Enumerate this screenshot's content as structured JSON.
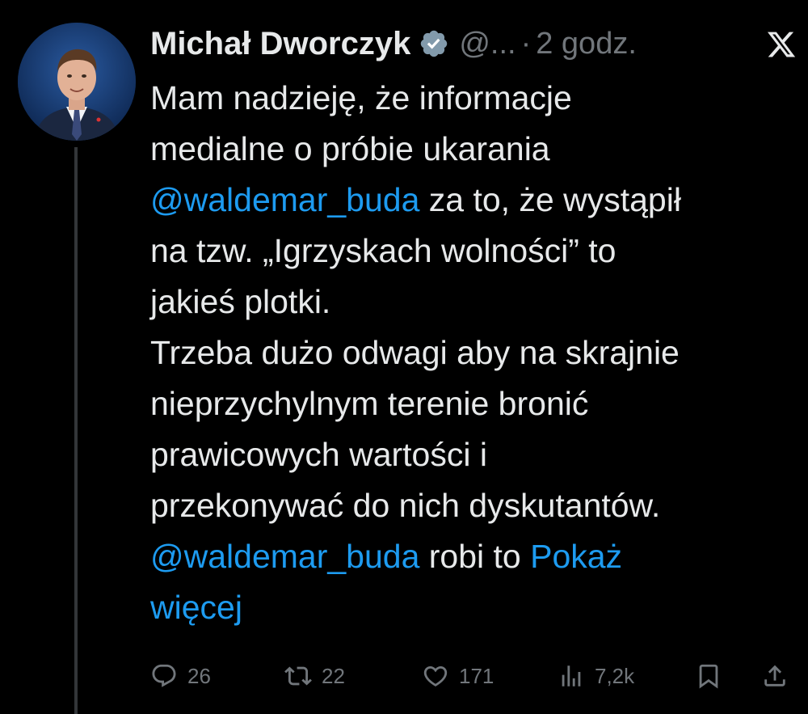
{
  "tweet": {
    "author_name": "Michał Dworczyk",
    "handle": "@...",
    "separator": "·",
    "time": "2 godz.",
    "verified_color": "#829aab",
    "lines": [
      {
        "segments": [
          {
            "text": "Mam nadzieję, że informacje",
            "type": "text"
          }
        ]
      },
      {
        "segments": [
          {
            "text": "medialne o próbie ukarania",
            "type": "text"
          }
        ]
      },
      {
        "segments": [
          {
            "text": "@waldemar_buda",
            "type": "mention"
          },
          {
            "text": " za to, że wystąpił",
            "type": "text"
          }
        ]
      },
      {
        "segments": [
          {
            "text": "na tzw. „Igrzyskach wolności” to",
            "type": "text"
          }
        ]
      },
      {
        "segments": [
          {
            "text": "jakieś plotki.",
            "type": "text"
          }
        ]
      },
      {
        "segments": [
          {
            "text": "Trzeba dużo odwagi aby na skrajnie",
            "type": "text"
          }
        ]
      },
      {
        "segments": [
          {
            "text": "nieprzychylnym terenie bronić",
            "type": "text"
          }
        ]
      },
      {
        "segments": [
          {
            "text": "prawicowych wartości i",
            "type": "text"
          }
        ]
      },
      {
        "segments": [
          {
            "text": "przekonywać do nich dyskutantów.",
            "type": "text"
          }
        ]
      },
      {
        "segments": [
          {
            "text": "@waldemar_buda",
            "type": "mention"
          },
          {
            "text": " robi to ",
            "type": "text"
          },
          {
            "text": "Pokaż",
            "type": "more"
          }
        ]
      },
      {
        "segments": [
          {
            "text": "więcej",
            "type": "more"
          }
        ]
      }
    ]
  },
  "actions": {
    "replies": "26",
    "retweets": "22",
    "likes": "171",
    "views": "7,2k"
  },
  "icons": {
    "platform": "x-logo-icon",
    "reply": "reply-icon",
    "retweet": "retweet-icon",
    "like": "heart-icon",
    "views": "views-icon",
    "bookmark": "bookmark-icon",
    "share": "share-icon"
  },
  "colors": {
    "background": "#000000",
    "text": "#e7e9ea",
    "secondary": "#71767b",
    "link": "#1d9bf0"
  }
}
